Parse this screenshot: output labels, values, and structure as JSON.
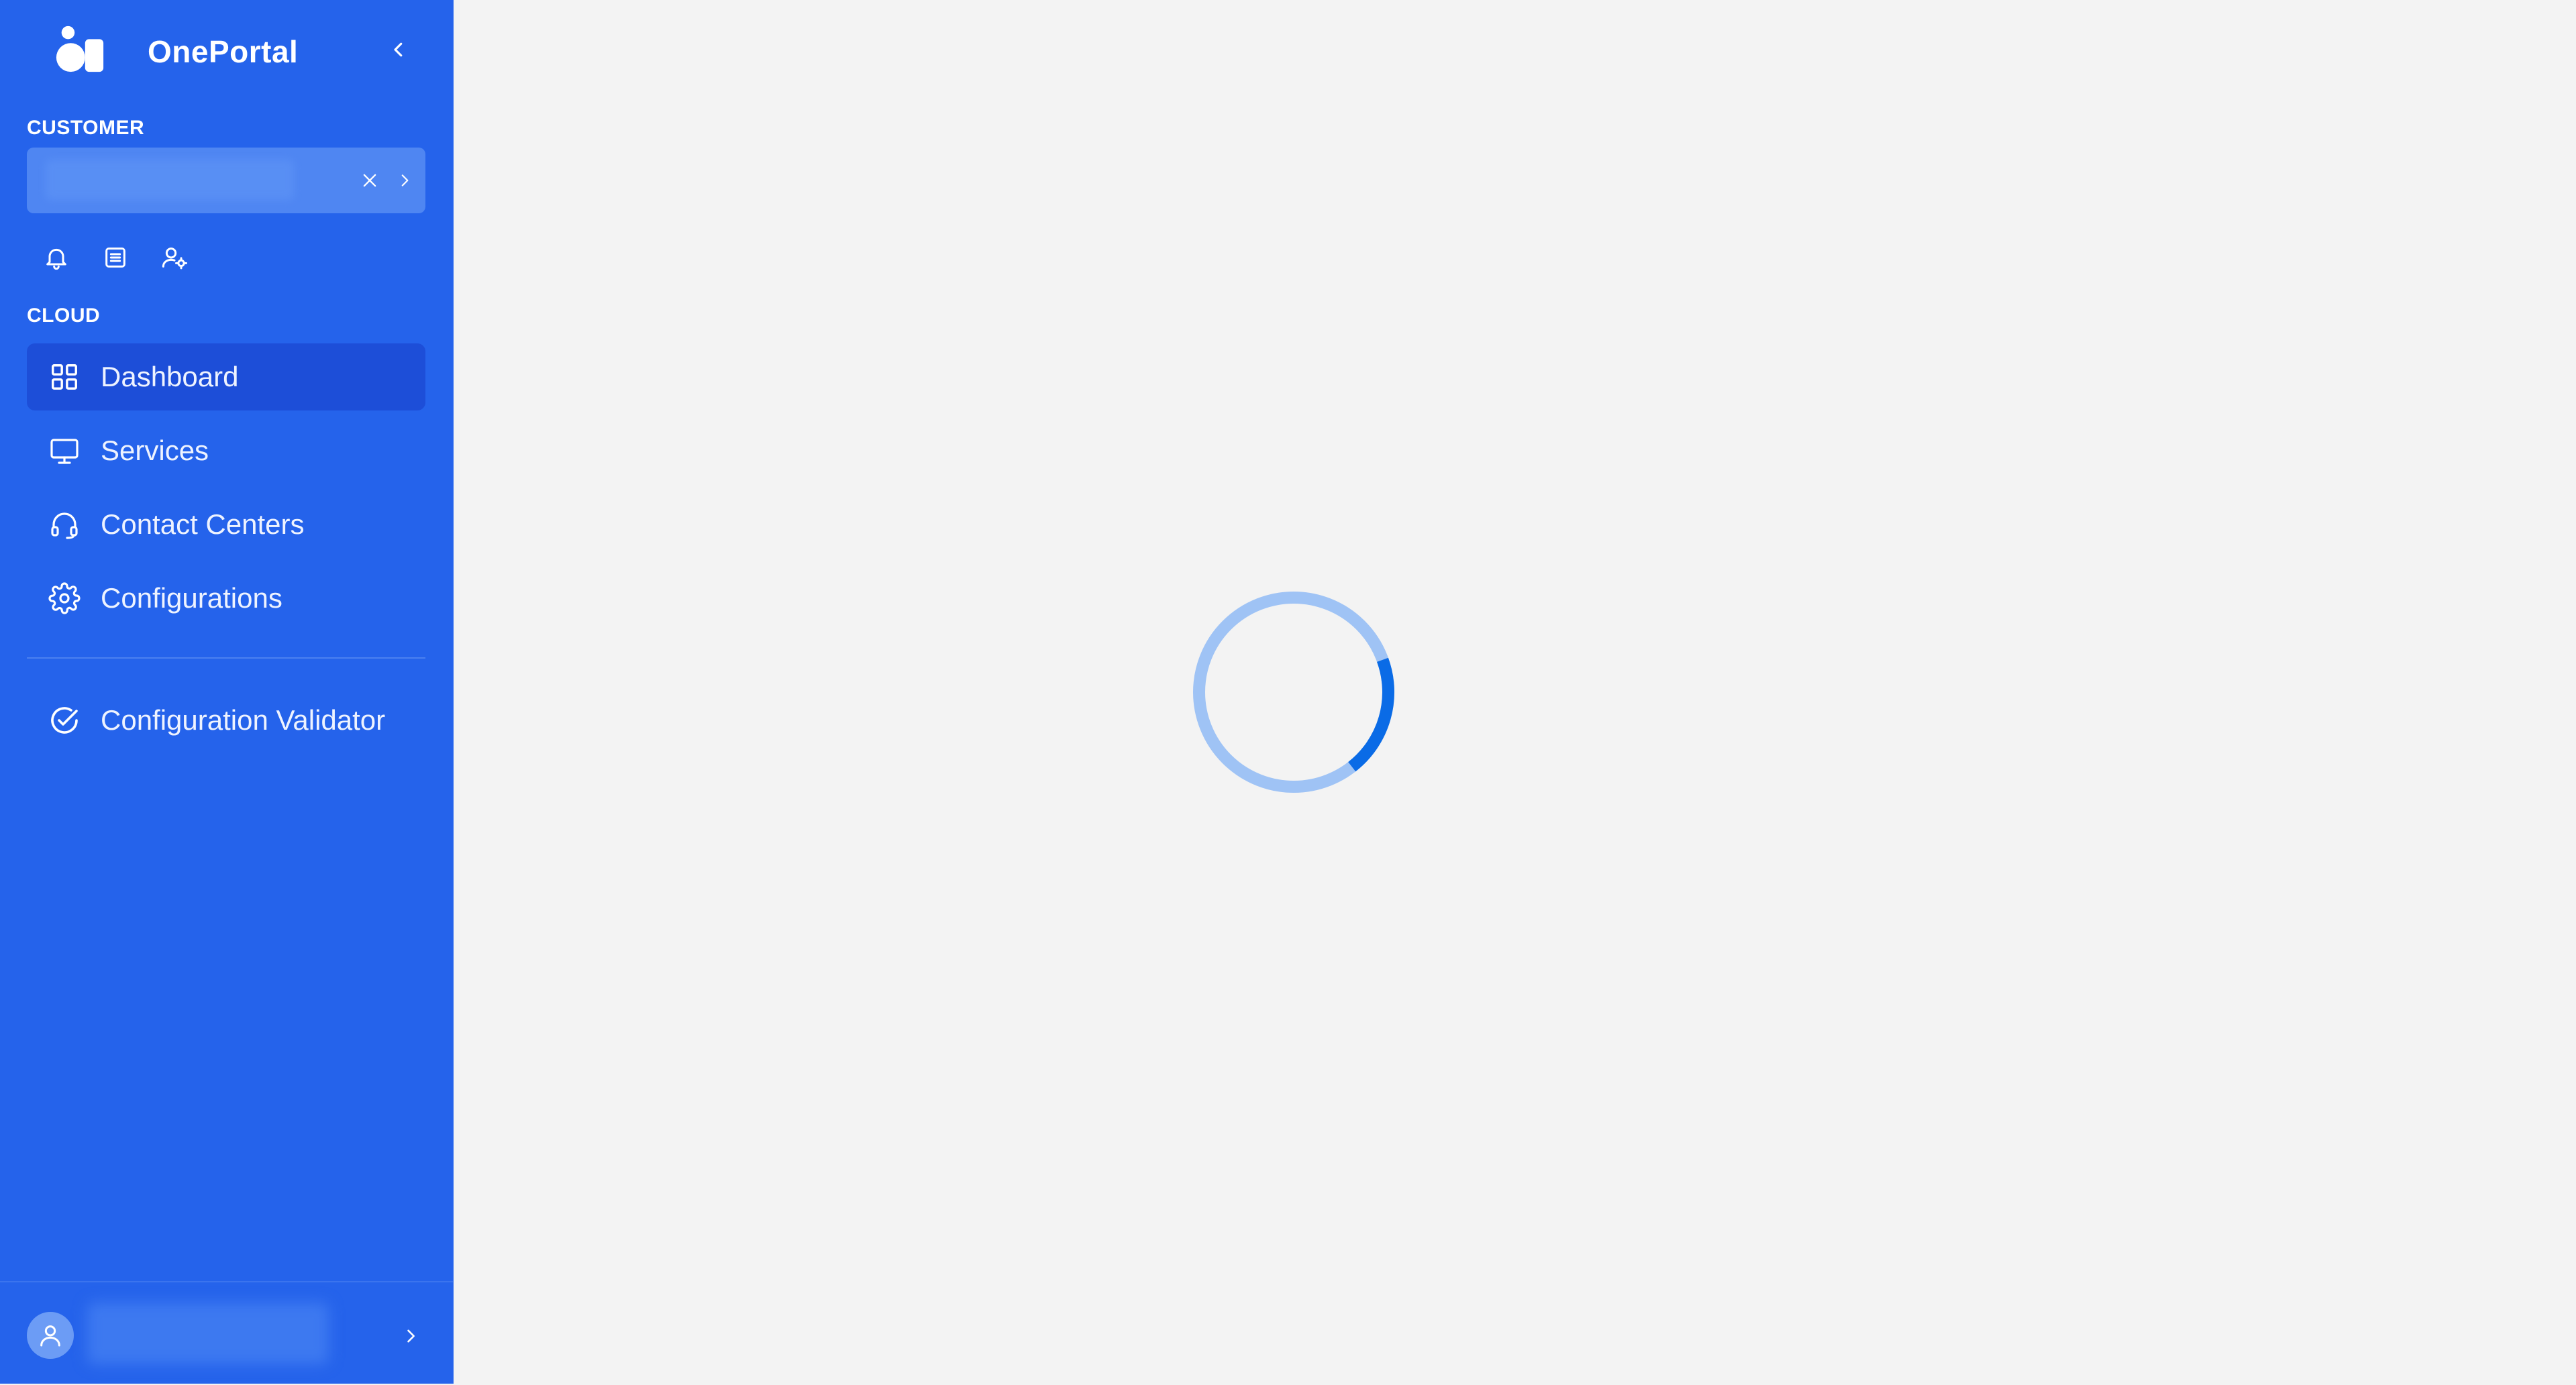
{
  "app": {
    "name": "OnePortal",
    "icons": {
      "logo": "oneportal-logo",
      "collapse": "chevron-left-icon"
    }
  },
  "customer": {
    "section_label": "CUSTOMER",
    "selected_value": "",
    "icons": {
      "clear": "close-icon",
      "open": "chevron-right-icon"
    }
  },
  "quick_actions": [
    {
      "name": "notifications",
      "icon": "bell-icon"
    },
    {
      "name": "logs",
      "icon": "list-icon"
    },
    {
      "name": "user-settings",
      "icon": "user-gear-icon"
    }
  ],
  "cloud": {
    "section_label": "CLOUD",
    "items": [
      {
        "label": "Dashboard",
        "icon": "grid-icon",
        "active": true
      },
      {
        "label": "Services",
        "icon": "monitor-icon",
        "active": false
      },
      {
        "label": "Contact Centers",
        "icon": "headset-icon",
        "active": false
      },
      {
        "label": "Configurations",
        "icon": "gear-icon",
        "active": false
      }
    ]
  },
  "tools": {
    "items": [
      {
        "label": "Configuration Validator",
        "icon": "check-circle-icon",
        "active": false
      }
    ]
  },
  "user": {
    "display_name": "",
    "icons": {
      "avatar": "user-icon",
      "open": "chevron-right-icon"
    }
  },
  "main": {
    "state": "loading",
    "spinner_progress": 0.2
  },
  "colors": {
    "sidebar": "#2563eb",
    "active_item": "#1d4ed8",
    "background": "#f3f3f3",
    "spinner_track": "#9fc3f5",
    "spinner_arc": "#0a6be6"
  }
}
